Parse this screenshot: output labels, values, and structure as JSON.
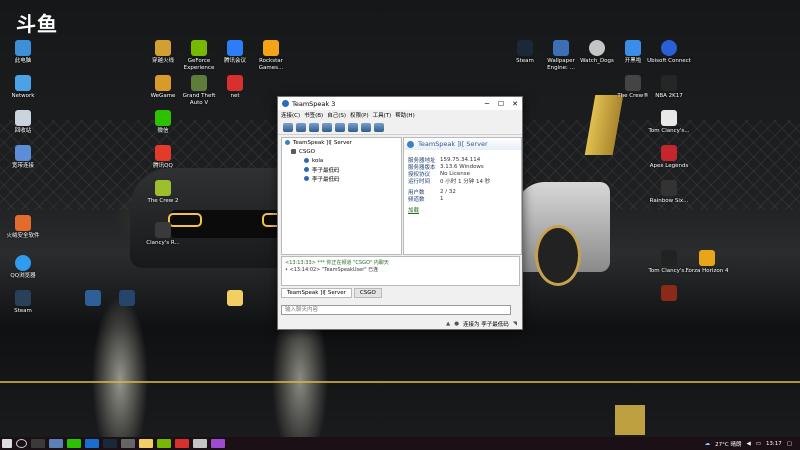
{
  "brand": "斗鱼",
  "desktop": {
    "left_icons": [
      "此电脑",
      "Network",
      "回收站",
      "宽带连接",
      "",
      "火绒安全软件",
      "QQ浏览器",
      "Steam"
    ],
    "mid_icons": [
      "穿越火线",
      "GeForce Experience",
      "腾讯会议",
      "Rockstar Games...",
      "WeGame",
      "Grand Theft Auto V",
      "net",
      "微信",
      "腾讯QQ",
      "The Crew 2",
      "Clancy's R..."
    ],
    "right_icons": [
      "Steam",
      "Wallpaper Engine: ...",
      "Watch_Dogs",
      "开黑啦",
      "Ubisoft Connect",
      "The Crew®",
      "NBA 2K17",
      "Tom Clancy's...",
      "Apex Legends",
      "Rainbow Six...",
      "Tom Clancy's...",
      "Forza Horizon 4"
    ]
  },
  "teamspeak": {
    "title": "TeamSpeak 3",
    "menu": [
      "连接(C)",
      "书签(B)",
      "自己(S)",
      "权限(P)",
      "工具(T)",
      "帮助(H)"
    ],
    "tree": {
      "server": "TeamSpeak ]I[ Server",
      "channel": "CSGO",
      "users": [
        "kola",
        "李子最低码",
        "李子最低码"
      ]
    },
    "info": {
      "header": "TeamSpeak ]I[ Server",
      "rows": [
        {
          "k": "服务器地址",
          "v": "159.75.34.114"
        },
        {
          "k": "服务器版本",
          "v": "3.13.6 Windows"
        },
        {
          "k": "授权协议",
          "v": "No License"
        },
        {
          "k": "运行时间",
          "v": "0 小时 1 分钟 14 秒"
        },
        {
          "k": "用户数",
          "v": "2 / 32"
        },
        {
          "k": "频道数",
          "v": "1"
        }
      ],
      "link": "加载"
    },
    "chat": [
      "<13:13:33> *** 你正在频道 \"CSGO\" 内聊天",
      "• <13:14:02> \"TeamSpeakUser\" 已连"
    ],
    "tabs": [
      "TeamSpeak ]I[ Server",
      "CSGO"
    ],
    "input_placeholder": "输入聊天内容",
    "status": "连接为 李子最低码"
  },
  "taskbar": {
    "weather": "27°C 晴朗",
    "time": "13:17"
  }
}
